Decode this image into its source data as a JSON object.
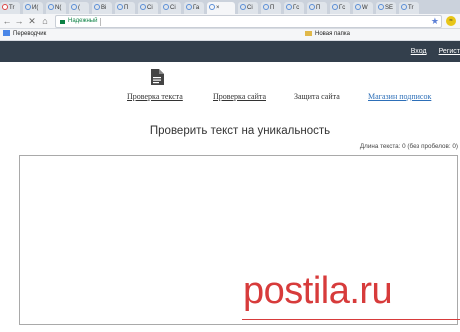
{
  "browser": {
    "tabs": [
      {
        "label": "Tr",
        "icon": "gmail"
      },
      {
        "label": "И(",
        "icon": "page"
      },
      {
        "label": "N(",
        "icon": "page"
      },
      {
        "label": "("
      },
      {
        "label": "Bi"
      },
      {
        "label": "П"
      },
      {
        "label": "Сі"
      },
      {
        "label": "Сі"
      },
      {
        "label": "Га"
      },
      {
        "label": "",
        "active": true
      },
      {
        "label": "Сі"
      },
      {
        "label": "П"
      },
      {
        "label": "Гс"
      },
      {
        "label": "П"
      },
      {
        "label": "Гс"
      },
      {
        "label": "W"
      },
      {
        "label": "SE"
      },
      {
        "label": "Tr"
      }
    ],
    "close_glyph": "×",
    "omnibox": {
      "label": "Надежный"
    },
    "bookmarks": {
      "translator": "Переводчик",
      "new_folder": "Новая папка"
    }
  },
  "header": {
    "login": "Вход",
    "register": "Регист"
  },
  "nav": {
    "check_text": "Проверка текста",
    "check_site": "Проверка сайта",
    "protect_site": "Защита сайта",
    "shop": "Магазин подписок"
  },
  "main": {
    "title": "Проверить текст на уникальность",
    "counter": "Длина текста: 0 (без пробелов: 0)"
  },
  "watermark": "postila.ru",
  "colors": {
    "header_bg": "#333f4c",
    "link_blue": "#2d6fb8",
    "watermark": "#d73b3b"
  }
}
